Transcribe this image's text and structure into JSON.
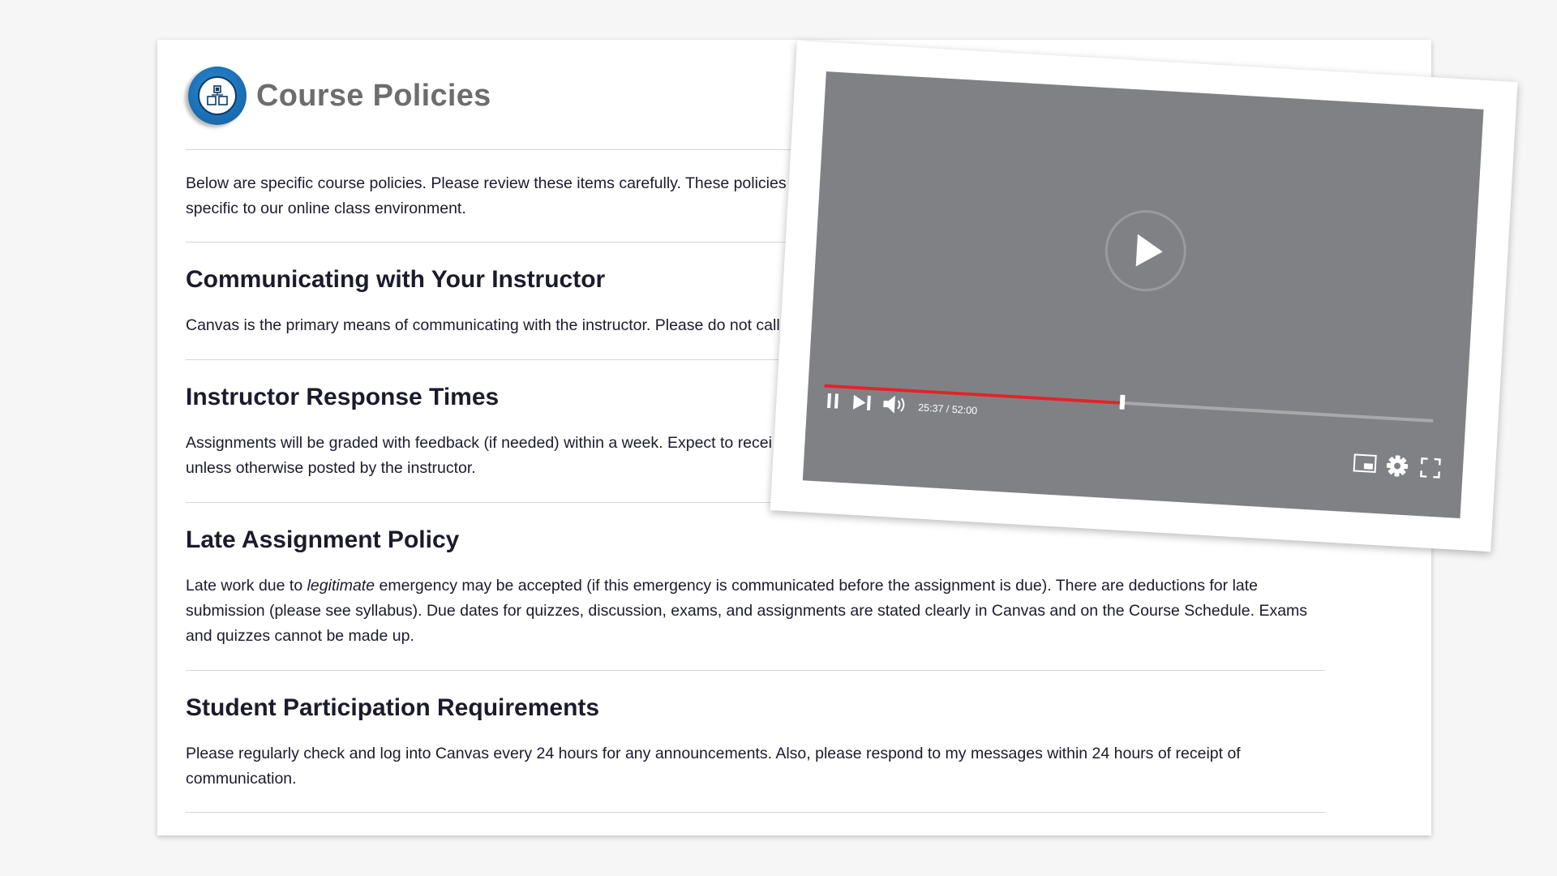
{
  "page": {
    "title": "Course Policies",
    "logo_icon": "hierarchy-icon"
  },
  "intro": {
    "line1": "Below are specific course policies. Please review these items carefully. These policies ar",
    "line2": "specific to our online class environment."
  },
  "sections": [
    {
      "heading": "Communicating with Your Instructor",
      "lines": [
        "Canvas is the primary means of communicating with the instructor. Please do not call"
      ]
    },
    {
      "heading": "Instructor Response Times",
      "lines": [
        "Assignments will be graded with feedback (if needed) within a week. Expect to recei",
        "unless otherwise posted by the instructor."
      ]
    },
    {
      "heading": "Late Assignment Policy",
      "line1_before": "Late work due to ",
      "line1_emph": "legitimate",
      "line1_after": " emergency may be accepted (if this emergency is communicated before the assignment is due). There are deductions for late",
      "lines": [
        "submission (please see syllabus). Due dates for quizzes, discussion, exams, and assignments are stated clearly in Canvas and on the Course Schedule. Exams",
        "and quizzes cannot be made up."
      ]
    },
    {
      "heading": "Student Participation Requirements",
      "lines": [
        "Please regularly check and log into Canvas every 24 hours for any announcements. Also, please respond to my messages within 24 hours of receipt of",
        "communication."
      ]
    }
  ],
  "video": {
    "time": "25:37 / 52:00",
    "progress_fraction": 0.49,
    "progress_color": "#e0242a",
    "screen_color": "#808184",
    "icons": {
      "play": "play-icon",
      "pause": "pause-icon",
      "next": "skip-next-icon",
      "volume": "volume-icon",
      "miniplayer": "miniplayer-icon",
      "settings": "gear-icon",
      "fullscreen": "fullscreen-icon"
    }
  }
}
